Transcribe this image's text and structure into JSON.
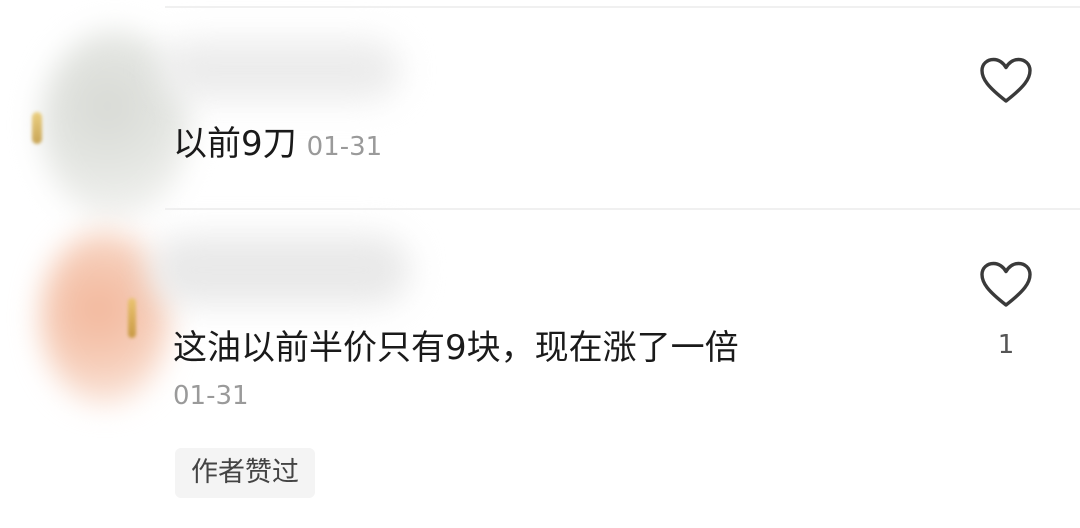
{
  "comments": [
    {
      "text": "以前9刀",
      "time": "01-31",
      "like_count": ""
    },
    {
      "text": "这油以前半价只有9块，现在涨了一倍",
      "time": "01-31",
      "like_count": "1",
      "author_badge": "作者赞过"
    }
  ],
  "icons": {
    "like": "heart-outline-icon",
    "like_color": "#3a3a3a"
  }
}
